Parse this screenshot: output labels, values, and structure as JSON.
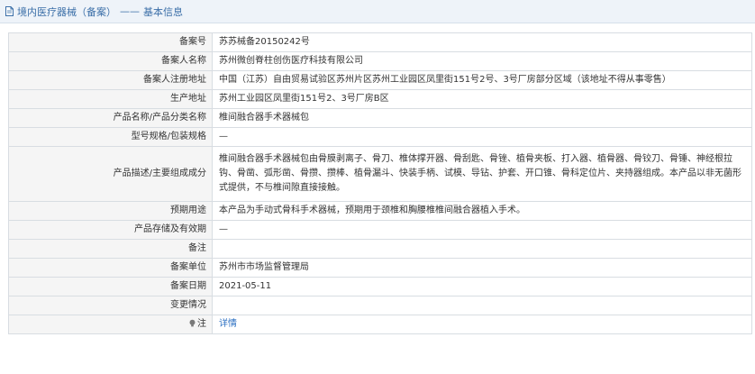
{
  "header": {
    "title": "境内医疗器械（备案）",
    "separator": "——",
    "subtitle": "基本信息"
  },
  "rows": [
    {
      "label": "备案号",
      "value": "苏苏械备20150242号"
    },
    {
      "label": "备案人名称",
      "value": "苏州微创脊柱创伤医疗科技有限公司"
    },
    {
      "label": "备案人注册地址",
      "value": "中国（江苏）自由贸易试验区苏州片区苏州工业园区凤里街151号2号、3号厂房部分区域（该地址不得从事零售）"
    },
    {
      "label": "生产地址",
      "value": "苏州工业园区凤里街151号2、3号厂房B区"
    },
    {
      "label": "产品名称/产品分类名称",
      "value": "椎间融合器手术器械包"
    },
    {
      "label": "型号规格/包装规格",
      "value": "—"
    },
    {
      "label": "产品描述/主要组成成分",
      "value": "椎间融合器手术器械包由骨膜剥离子、骨刀、椎体撑开器、骨刮匙、骨锉、植骨夹板、打入器、植骨器、骨铰刀、骨锤、神经根拉钩、骨凿、弧形凿、骨攒、攒棒、植骨漏斗、快装手柄、试模、导钻、护套、开口锥、骨科定位片、夹持器组成。本产品以非无菌形式提供，不与椎间隙直接接触。"
    },
    {
      "label": "预期用途",
      "value": "本产品为手动式骨科手术器械，预期用于颈椎和胸腰椎椎间融合器植入手术。"
    },
    {
      "label": "产品存储及有效期",
      "value": "—"
    },
    {
      "label": "备注",
      "value": ""
    },
    {
      "label": "备案单位",
      "value": "苏州市市场监督管理局"
    },
    {
      "label": "备案日期",
      "value": "2021-05-11"
    },
    {
      "label": "变更情况",
      "value": ""
    }
  ],
  "note_row": {
    "label": "注",
    "link": "详情"
  },
  "colors": {
    "header_text": "#3b6fa8",
    "label_bg": "#f5f5f5",
    "link": "#2b6fc2"
  },
  "icons": {
    "header": "document-icon",
    "note": "bulb-icon"
  }
}
